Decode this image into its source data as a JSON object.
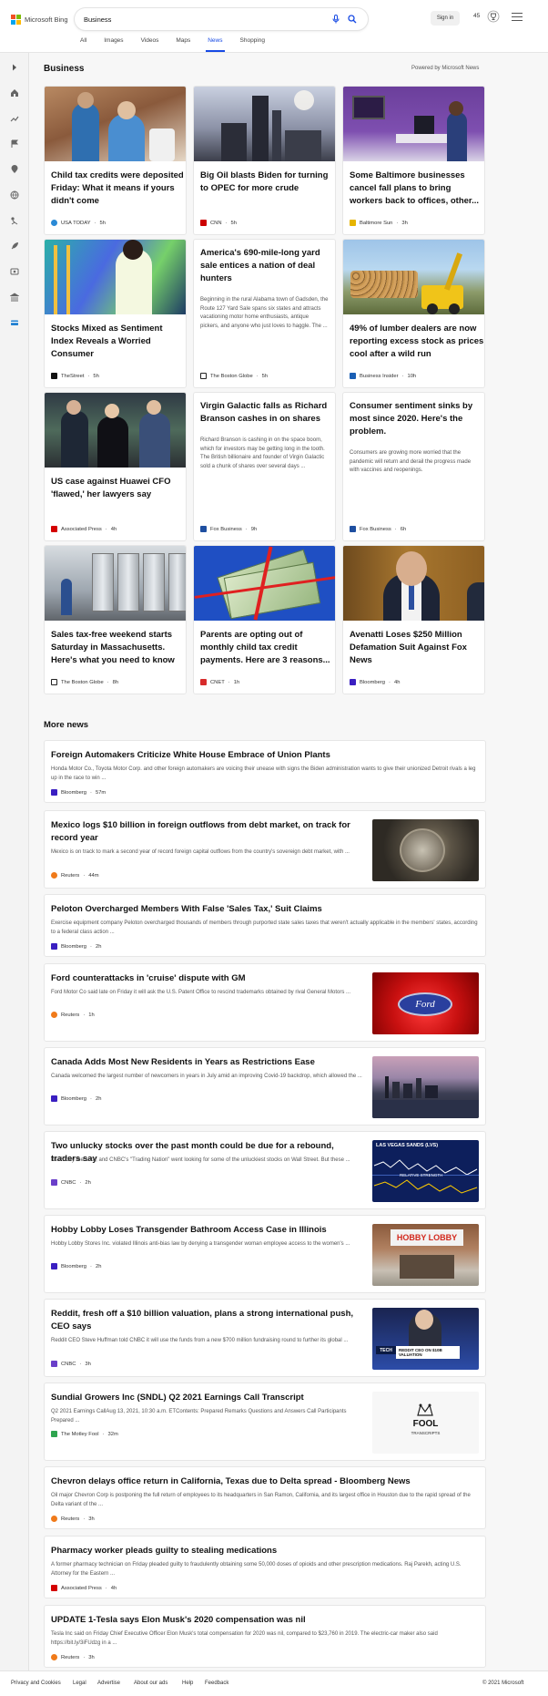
{
  "header": {
    "logo_text": "Microsoft Bing",
    "query": "Business",
    "signin": "Sign in",
    "points": "45"
  },
  "tabs": [
    "All",
    "Images",
    "Videos",
    "Maps",
    "News",
    "Shopping"
  ],
  "active_tab": "News",
  "section": {
    "title": "Business",
    "powered": "Powered by Microsoft News"
  },
  "cards": [
    {
      "title": "Child tax credits were deposited Friday: What it means if yours didn't come",
      "body": "",
      "source": "USA TODAY",
      "time": "5h",
      "fav": "#2a8ad6"
    },
    {
      "title": "Big Oil blasts Biden for turning to OPEC for more crude",
      "body": "",
      "source": "CNN",
      "time": "5h",
      "fav": "#cc0000"
    },
    {
      "title": "Some Baltimore businesses cancel fall plans to bring workers back to offices, other...",
      "body": "",
      "source": "Baltimore Sun",
      "time": "3h",
      "fav": "#e6b400"
    },
    {
      "title": "Stocks Mixed as Sentiment Index Reveals a Worried Consumer",
      "body": "",
      "source": "TheStreet",
      "time": "5h",
      "fav": "#111111"
    },
    {
      "title": "America's 690-mile-long yard sale entices a nation of deal hunters",
      "body": "Beginning in the rural Alabama town of Gadsden, the Route 127 Yard Sale spans six states and attracts vacationing motor home enthusiasts, antique pickers, and anyone who just loves to haggle. The ...",
      "source": "The Boston Globe",
      "time": "5h",
      "fav": "#222222"
    },
    {
      "title": "49% of lumber dealers are now reporting excess stock as prices cool after a wild run",
      "body": "",
      "source": "Business Insider",
      "time": "10h",
      "fav": "#1a5fb4"
    },
    {
      "title": "US case against Huawei CFO 'flawed,' her lawyers say",
      "body": "",
      "source": "Associated Press",
      "time": "4h",
      "fav": "#d40000"
    },
    {
      "title": "Virgin Galactic falls as Richard Branson cashes in on shares",
      "body": "Richard Branson is cashing in on the space boom, which for investors may be getting long in the tooth. The British billionaire and founder of Virgin Galactic sold a chunk of shares over several days ...",
      "source": "Fox Business",
      "time": "9h",
      "fav": "#1e4fa0"
    },
    {
      "title": "Consumer sentiment sinks by most since 2020. Here's the problem.",
      "body": "Consumers are growing more worried that the pandemic will return and derail the progress made with vaccines and reopenings.",
      "source": "Fox Business",
      "time": "6h",
      "fav": "#1e4fa0"
    },
    {
      "title": "Sales tax-free weekend starts Saturday in Massachusetts. Here's what you need to know",
      "body": "",
      "source": "The Boston Globe",
      "time": "8h",
      "fav": "#222222"
    },
    {
      "title": "Parents are opting out of monthly child tax credit payments. Here are 3 reasons...",
      "body": "",
      "source": "CNET",
      "time": "1h",
      "fav": "#d72b2b"
    },
    {
      "title": "Avenatti Loses $250 Million Defamation Suit Against Fox News",
      "body": "",
      "source": "Bloomberg",
      "time": "4h",
      "fav": "#3a1fc1"
    }
  ],
  "more_title": "More news",
  "rows": [
    {
      "title": "Foreign Automakers Criticize White House Embrace of Union Plants",
      "desc": "Honda Motor Co., Toyota Motor Corp. and other foreign automakers are voicing their unease with signs the Biden administration wants to give their unionized Detroit rivals a leg up in the race to win ...",
      "source": "Bloomberg",
      "time": "57m",
      "fav": "#3a1fc1"
    },
    {
      "title": "Mexico logs $10 billion in foreign outflows from debt market, on track for record year",
      "desc": "Mexico is on track to mark a second year of record foreign capital outflows from the country's sovereign debt market, with ...",
      "source": "Reuters",
      "time": "44m",
      "fav": "#f07a1a"
    },
    {
      "title": "Peloton Overcharged Members With False 'Sales Tax,' Suit Claims",
      "desc": "Exercise equipment company Peloton overcharged thousands of members through purported state sales taxes that weren't actually applicable in the members' states, according to a federal class action ...",
      "source": "Bloomberg",
      "time": "2h",
      "fav": "#3a1fc1"
    },
    {
      "title": "Ford counterattacks in 'cruise' dispute with GM",
      "desc": "Ford Motor Co said late on Friday it will ask the U.S. Patent Office to rescind trademarks obtained by rival General Motors ...",
      "source": "Reuters",
      "time": "1h",
      "fav": "#f07a1a"
    },
    {
      "title": "Canada Adds Most New Residents in Years as Restrictions Ease",
      "desc": "Canada welcomed the largest number of newcomers in years in July amid an improving Covid-19 backdrop, which allowed the ...",
      "source": "Bloomberg",
      "time": "2h",
      "fav": "#3a1fc1"
    },
    {
      "title": "Two unlucky stocks over the past month could be due for a rebound, traders say",
      "desc": "It's Friday the 13th, and CNBC's \"Trading Nation\" went looking for some of the unluckiest stocks on Wall Street. But these ...",
      "source": "CNBC",
      "time": "2h",
      "fav": "#6a3fc9"
    },
    {
      "title": "Hobby Lobby Loses Transgender Bathroom Access Case in Illinois",
      "desc": "Hobby Lobby Stores Inc. violated Illinois anti-bias law by denying a transgender woman employee access to the women's ...",
      "source": "Bloomberg",
      "time": "2h",
      "fav": "#3a1fc1"
    },
    {
      "title": "Reddit, fresh off a $10 billion valuation, plans a strong international push, CEO says",
      "desc": "Reddit CEO Steve Huffman told CNBC it will use the funds from a new $700 million fundraising round to further its global ...",
      "source": "CNBC",
      "time": "3h",
      "fav": "#6a3fc9"
    },
    {
      "title": "Sundial Growers Inc (SNDL) Q2 2021 Earnings Call Transcript",
      "desc": "Q2 2021 Earnings CallAug 13, 2021, 10:30 a.m. ETContents: Prepared Remarks Questions and Answers Call Participants Prepared ...",
      "source": "The Motley Fool",
      "time": "32m",
      "fav": "#2ea44f"
    },
    {
      "title": "Chevron delays office return in California, Texas due to Delta spread - Bloomberg News",
      "desc": "Oil major Chevron Corp is postponing the full return of employees to its headquarters in San Ramon, California, and its largest office in Houston due to the rapid spread of the Delta variant of the ...",
      "source": "Reuters",
      "time": "3h",
      "fav": "#f07a1a"
    },
    {
      "title": "Pharmacy worker pleads guilty to stealing medications",
      "desc": "A former pharmacy technician on Friday pleaded guilty to fraudulently obtaining some 50,000 doses of opioids and other prescription medications. Raj Parekh, acting U.S. Attorney for the Eastern ...",
      "source": "Associated Press",
      "time": "4h",
      "fav": "#d40000"
    },
    {
      "title": "UPDATE 1-Tesla says Elon Musk's 2020 compensation was nil",
      "desc": "Tesla Inc said on Friday Chief Executive Officer Elon Musk's total compensation for 2020 was nil, compared to $23,760 in 2019. The electric-car maker also said https://bit.ly/3iFUdzg in a ...",
      "source": "Reuters",
      "time": "3h",
      "fav": "#f07a1a"
    }
  ],
  "thumbs": {
    "stock_chart_title": "LAS VEGAS SANDS (LVS)",
    "stock_chart_sub": "RELATIVE STRENGTH",
    "hobby_sign": "HOBBY LOBBY",
    "reddit_banner": "REDDIT CEO ON $10B VALUATION",
    "reddit_tag": "TECH",
    "fool_logo": "FOOL",
    "fool_sub": "TRANSCRIPTS",
    "ford_logo": "Ford"
  },
  "footer": {
    "links": [
      "Privacy and Cookies",
      "Legal",
      "Advertise",
      "About our ads",
      "Help",
      "Feedback"
    ],
    "copyright": "© 2021 Microsoft"
  }
}
